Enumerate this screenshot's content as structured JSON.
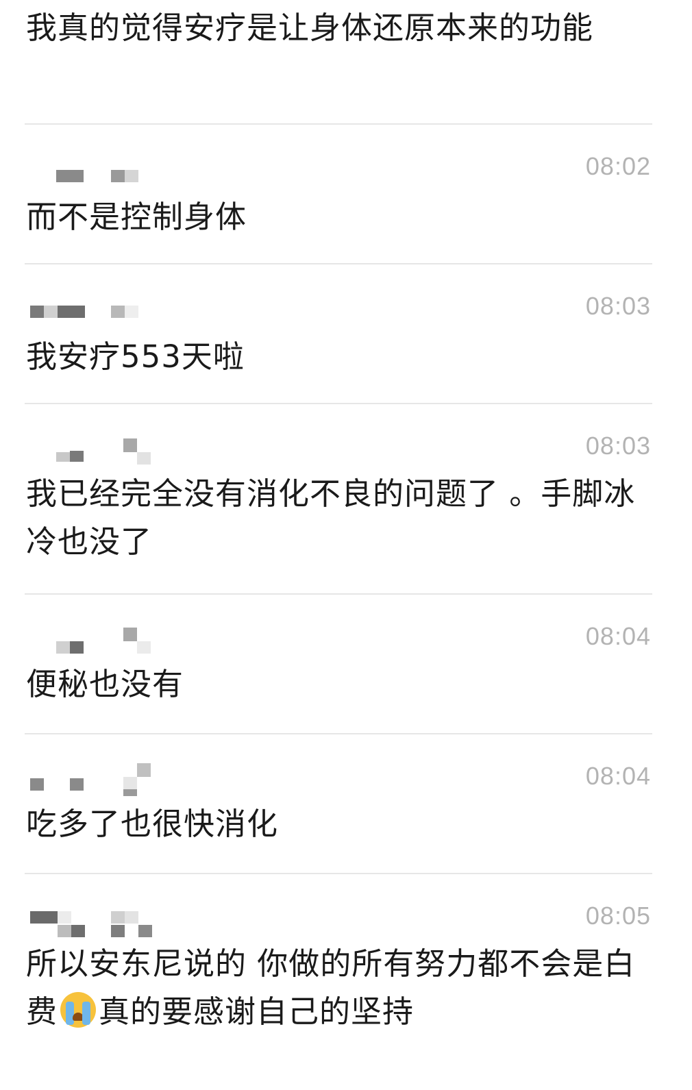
{
  "top_message": "我真的觉得安疗是让身体还原本来的功能",
  "messages": [
    {
      "time": "08:02",
      "text": "而不是控制身体"
    },
    {
      "time": "08:03",
      "text": "我安疗553天啦"
    },
    {
      "time": "08:03",
      "text": "我已经完全没有消化不良的问题了 。手脚冰冷也没了"
    },
    {
      "time": "08:04",
      "text": "便秘也没有"
    },
    {
      "time": "08:04",
      "text": "吃多了也很快消化"
    },
    {
      "time": "08:05",
      "text_before": "所以安东尼说的 你做的所有努力都不会是白费",
      "emoji": "loudly-crying-face-emoji",
      "text_after": "真的要感谢自己的坚持"
    }
  ]
}
